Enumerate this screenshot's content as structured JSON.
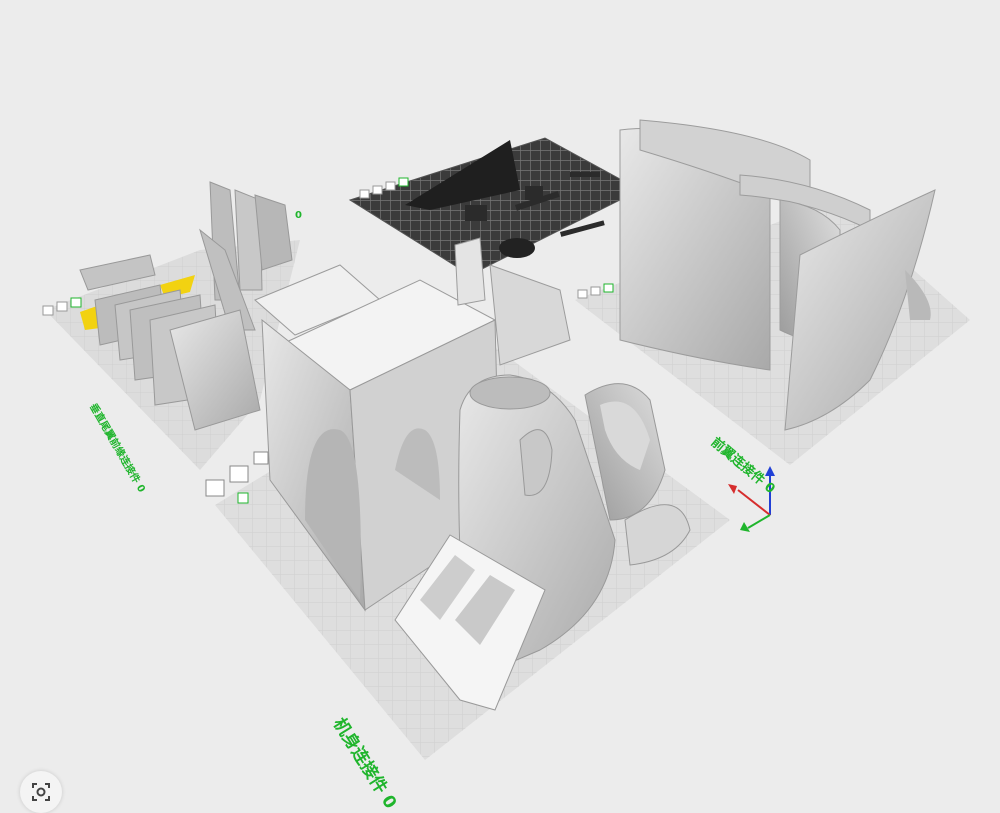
{
  "plates": [
    {
      "id": "main",
      "label": "机身连接件 0"
    },
    {
      "id": "left",
      "label": "垂直尾翼前缘连接件 0"
    },
    {
      "id": "right",
      "label": "前翼连接件 0"
    },
    {
      "id": "back",
      "label": "0"
    }
  ],
  "icons": {
    "plate_tools": "plate-tool-icons",
    "axes": "axis-gizmo-icon",
    "lens": "image-search-icon"
  },
  "colors": {
    "plate": "#d9d9d9",
    "grid": "#c8c8c8",
    "label": "#1fb52c",
    "part": "#c9c9c9",
    "part_dark": "#2a2a2a",
    "support": "#f2d211"
  }
}
